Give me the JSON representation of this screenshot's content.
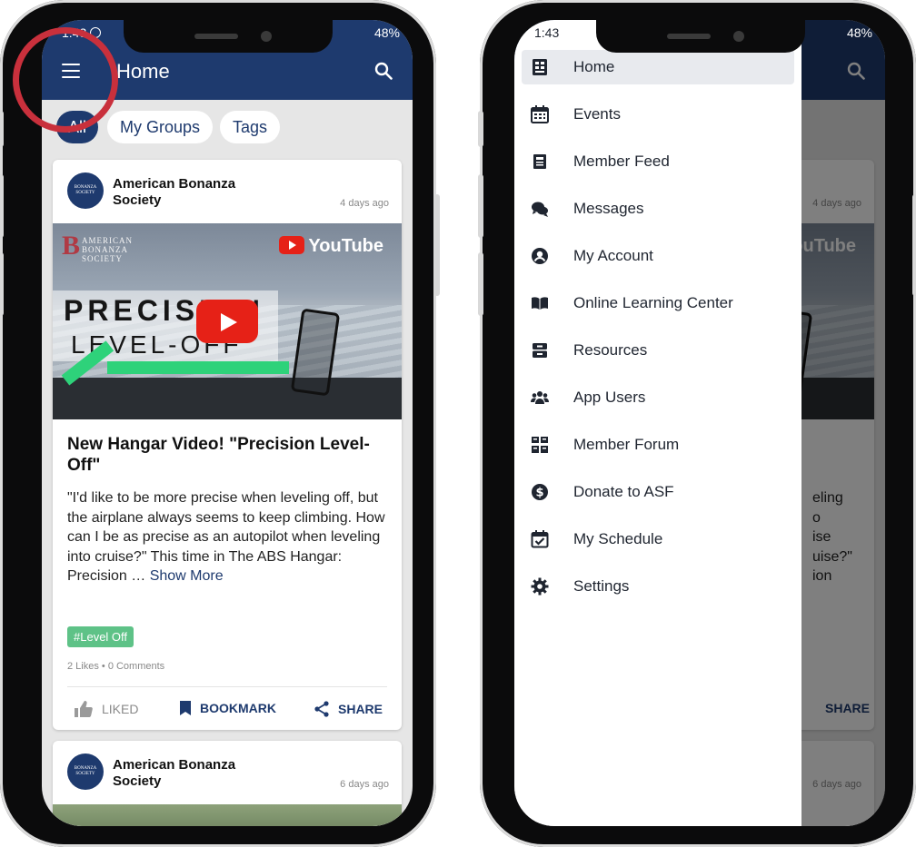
{
  "status": {
    "time": "1:43",
    "battery": "48%"
  },
  "left_phone": {
    "app_title": "Home",
    "chips": [
      "All",
      "My Groups",
      "Tags"
    ],
    "post1": {
      "org": "American Bonanza Society",
      "time": "4 days ago",
      "video": {
        "overlay_line1": "PRECISION",
        "overlay_line2": "LEVEL-OFF",
        "logo_letter": "B",
        "logo_text": "AMERICAN BONANZA SOCIETY",
        "brand": "YouTube"
      },
      "title": "New Hangar Video! \"Precision Level-Off\"",
      "body": "\"I'd like to be more precise when leveling off, but the airplane always seems to keep climbing. How can I be as precise as an autopilot when leveling into cruise?\" This time in The ABS Hangar: Precision … ",
      "show_more": "Show More",
      "tag": "#Level Off",
      "stats": "2 Likes • 0 Comments",
      "actions": {
        "like": "LIKED",
        "bookmark": "BOOKMARK",
        "share": "SHARE"
      }
    },
    "post2": {
      "org": "American Bonanza Society",
      "time": "6 days ago"
    }
  },
  "right_phone": {
    "drawer_items": [
      {
        "label": "Home",
        "icon": "home-icon"
      },
      {
        "label": "Events",
        "icon": "calendar-icon"
      },
      {
        "label": "Member Feed",
        "icon": "newspaper-icon"
      },
      {
        "label": "Messages",
        "icon": "chat-icon"
      },
      {
        "label": "My Account",
        "icon": "account-icon"
      },
      {
        "label": "Online Learning Center",
        "icon": "book-icon"
      },
      {
        "label": "Resources",
        "icon": "archive-icon"
      },
      {
        "label": "App Users",
        "icon": "users-icon"
      },
      {
        "label": "Member Forum",
        "icon": "forum-icon"
      },
      {
        "label": "Donate to ASF",
        "icon": "dollar-icon"
      },
      {
        "label": "My Schedule",
        "icon": "schedule-icon"
      },
      {
        "label": "Settings",
        "icon": "gear-icon"
      }
    ],
    "behind": {
      "time1": "4 days ago",
      "brand": "YouTube",
      "body_fragments": [
        "eling",
        "o",
        "ise",
        "uise?\"",
        "ion"
      ],
      "share": "SHARE",
      "time2": "6 days ago"
    }
  },
  "colors": {
    "brand": "#1e3a6e",
    "highlight": "#c9303c",
    "tag": "#5ec287"
  }
}
